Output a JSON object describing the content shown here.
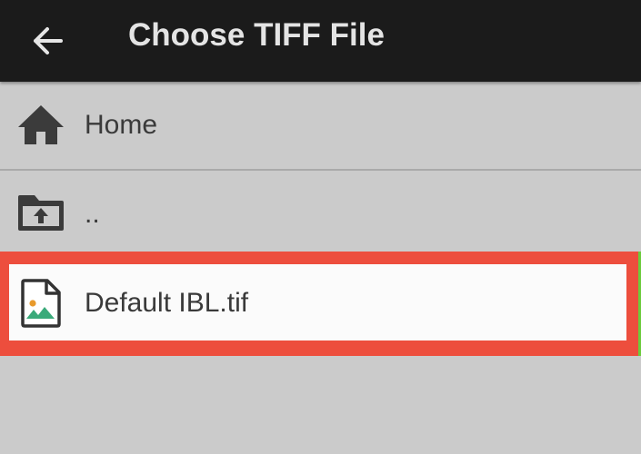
{
  "header": {
    "back_icon": "arrow-left-icon",
    "title": "Choose TIFF File"
  },
  "list": {
    "items": [
      {
        "icon": "home-icon",
        "label": "Home"
      },
      {
        "icon": "folder-upload-icon",
        "label": ".."
      },
      {
        "icon": "image-file-icon",
        "label": "Default IBL.tif",
        "selected": true
      }
    ]
  },
  "colors": {
    "app_bar": "#1b1b1b",
    "background": "#cbcbcb",
    "highlight_border": "#ed4e3d",
    "selected_row": "#fbfbfb",
    "text": "#3a3a3a"
  }
}
